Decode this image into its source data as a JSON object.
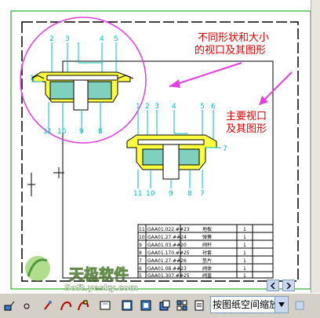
{
  "annotations": {
    "viewport_note_line1": "不同形状和大小",
    "viewport_note_line2": "的视口及其图形",
    "main_note_line1": "主要视口",
    "main_note_line2": "及其图形"
  },
  "detail_labels": {
    "small_top": [
      "2",
      "3",
      "4",
      "5"
    ],
    "small_bottom": [
      "11",
      "10",
      "9",
      "8"
    ],
    "small_left": "1",
    "main_top": [
      "1",
      "2",
      "3",
      "4",
      "5",
      "6"
    ],
    "main_bottom": [
      "11",
      "10",
      "9",
      "8",
      "7"
    ],
    "main_right": "7"
  },
  "parts_table": {
    "rows": [
      {
        "no": "11",
        "code": "GAA01.022.##23",
        "name": "地板",
        "qty": "1"
      },
      {
        "no": "10",
        "code": "GAA01.27.##24",
        "name": "弹簧",
        "qty": "1"
      },
      {
        "no": "9",
        "code": "GAA01.03.##20",
        "name": "阀杆",
        "qty": "1"
      },
      {
        "no": "8",
        "code": "GAA01.170.##25",
        "name": "衬套",
        "qty": "1"
      },
      {
        "no": "7",
        "code": "GAA01.27.##26",
        "name": "垫片",
        "qty": "1"
      },
      {
        "no": "6",
        "code": "GAA01.08.##23",
        "name": "阀体",
        "qty": "1"
      },
      {
        "no": "5",
        "code": "GAA01.307.##25",
        "name": "阀盖",
        "qty": "1"
      }
    ]
  },
  "watermark": {
    "brand_cn": "天极软件",
    "brand_url": "Soft.yesky.com"
  },
  "statusbar": {
    "scale_value": "按图纸空间缩放",
    "icons": [
      "snap-icon",
      "circle-icon",
      "pan-icon",
      "zoom-icon",
      "layer-icon",
      "viewport-icon",
      "window-icon",
      "tile-icon",
      "clip-icon",
      "lock-icon",
      "paper-icon",
      "refresh-icon"
    ]
  },
  "colors": {
    "frame_green": "#00a000",
    "annotation_red": "#e00000",
    "arrow_magenta": "#e040e0",
    "leader_cyan": "#00c0c0",
    "fill_yellow": "#ffff40",
    "fill_teal": "#80d0c0"
  }
}
